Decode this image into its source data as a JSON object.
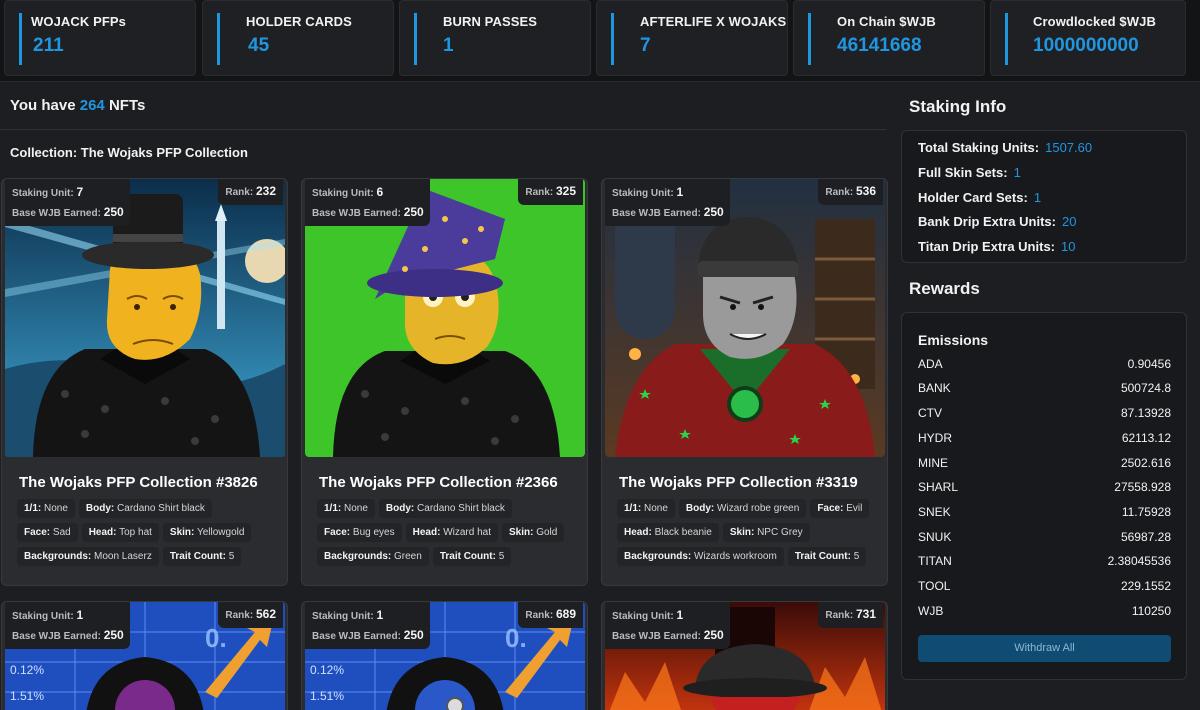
{
  "stats": [
    {
      "label": "WOJACK PFPs",
      "value": "211"
    },
    {
      "label": "HOLDER CARDS",
      "value": "45"
    },
    {
      "label": "BURN PASSES",
      "value": "1"
    },
    {
      "label": "AFTERLIFE X WOJAKS",
      "value": "7"
    },
    {
      "label": "On Chain $WJB",
      "value": "46141668"
    },
    {
      "label": "Crowdlocked $WJB",
      "value": "1000000000"
    }
  ],
  "summary": {
    "prefix": "You have",
    "count": "264",
    "suffix": "NFTs"
  },
  "collection_title": "Collection: The Wojaks PFP Collection",
  "labels": {
    "staking_unit": "Staking Unit:",
    "base_wjb": "Base WJB Earned:",
    "rank": "Rank:"
  },
  "cards": [
    {
      "staking_unit": "7",
      "base_wjb": "250",
      "rank": "232",
      "title": "The Wojaks PFP Collection #3826",
      "traits": [
        [
          "1/1:",
          "None"
        ],
        [
          "Body:",
          "Cardano Shirt black"
        ],
        [
          "Face:",
          "Sad"
        ],
        [
          "Head:",
          "Top hat"
        ],
        [
          "Skin:",
          "Yellowgold"
        ],
        [
          "Backgrounds:",
          "Moon Laserz"
        ],
        [
          "Trait Count:",
          "5"
        ]
      ]
    },
    {
      "staking_unit": "6",
      "base_wjb": "250",
      "rank": "325",
      "title": "The Wojaks PFP Collection #2366",
      "traits": [
        [
          "1/1:",
          "None"
        ],
        [
          "Body:",
          "Cardano Shirt black"
        ],
        [
          "Face:",
          "Bug eyes"
        ],
        [
          "Head:",
          "Wizard hat"
        ],
        [
          "Skin:",
          "Gold"
        ],
        [
          "Backgrounds:",
          "Green"
        ],
        [
          "Trait Count:",
          "5"
        ]
      ]
    },
    {
      "staking_unit": "1",
      "base_wjb": "250",
      "rank": "536",
      "title": "The Wojaks PFP Collection #3319",
      "traits": [
        [
          "1/1:",
          "None"
        ],
        [
          "Body:",
          "Wizard robe green"
        ],
        [
          "Face:",
          "Evil"
        ],
        [
          "Head:",
          "Black beanie"
        ],
        [
          "Skin:",
          "NPC Grey"
        ],
        [
          "Backgrounds:",
          "Wizards workroom"
        ],
        [
          "Trait Count:",
          "5"
        ]
      ]
    },
    {
      "staking_unit": "1",
      "base_wjb": "250",
      "rank": "562"
    },
    {
      "staking_unit": "1",
      "base_wjb": "250",
      "rank": "689"
    },
    {
      "staking_unit": "1",
      "base_wjb": "250",
      "rank": "731"
    }
  ],
  "staking_info": {
    "heading": "Staking Info",
    "rows": [
      {
        "label": "Total Staking Units:",
        "value": "1507.60"
      },
      {
        "label": "Full Skin Sets:",
        "value": "1"
      },
      {
        "label": "Holder Card Sets:",
        "value": "1"
      },
      {
        "label": "Bank Drip Extra Units:",
        "value": "20"
      },
      {
        "label": "Titan Drip Extra Units:",
        "value": "10"
      }
    ]
  },
  "rewards": {
    "heading": "Rewards",
    "emissions_title": "Emissions",
    "items": [
      {
        "token": "ADA",
        "amount": "0.90456"
      },
      {
        "token": "BANK",
        "amount": "500724.8"
      },
      {
        "token": "CTV",
        "amount": "87.13928"
      },
      {
        "token": "HYDR",
        "amount": "62113.12"
      },
      {
        "token": "MINE",
        "amount": "2502.616"
      },
      {
        "token": "SHARL",
        "amount": "27558.928"
      },
      {
        "token": "SNEK",
        "amount": "11.75928"
      },
      {
        "token": "SNUK",
        "amount": "56987.28"
      },
      {
        "token": "TITAN",
        "amount": "2.38045536"
      },
      {
        "token": "TOOL",
        "amount": "229.1552"
      },
      {
        "token": "WJB",
        "amount": "110250"
      }
    ],
    "withdraw_label": "Withdraw All"
  },
  "colors": {
    "accent": "#2196e0",
    "background": "#1d1e21",
    "card": "#2b2c30",
    "button": "#0f4b73"
  }
}
